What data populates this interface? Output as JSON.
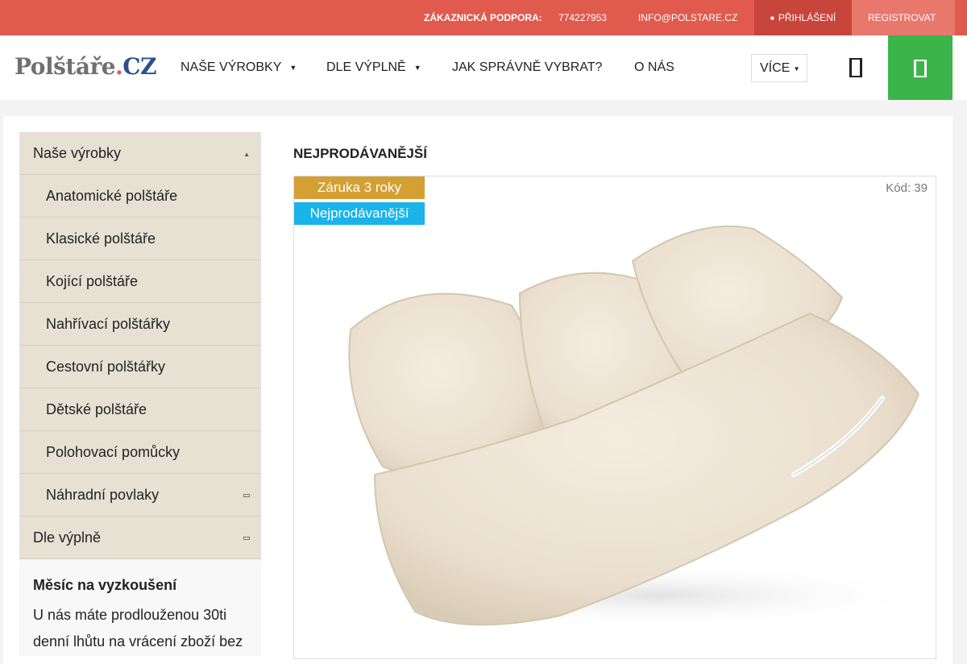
{
  "topbar": {
    "support_label": "ZÁKAZNICKÁ PODPORA:",
    "phone": "774227953",
    "email": "INFO@POLSTARE.CZ",
    "login": "PŘIHLÁŠENÍ",
    "register": "REGISTROVAT"
  },
  "header": {
    "logo_main": "Polštáře",
    "logo_dot": ".",
    "logo_tld": "CZ",
    "nav": [
      {
        "label": "NAŠE VÝROBKY"
      },
      {
        "label": "DLE VÝPLNĚ"
      },
      {
        "label": "JAK SPRÁVNĚ VYBRAT?"
      },
      {
        "label": "O NÁS"
      }
    ],
    "more": "VÍCE"
  },
  "sidebar": {
    "items": [
      {
        "label": "Naše výrobky"
      },
      {
        "label": "Anatomické polštáře"
      },
      {
        "label": "Klasické polštáře"
      },
      {
        "label": "Kojící polštáře"
      },
      {
        "label": "Nahřívací polštářky"
      },
      {
        "label": "Cestovní polštářky"
      },
      {
        "label": "Dětské polštáře"
      },
      {
        "label": "Polohovací pomůcky"
      },
      {
        "label": "Náhradní povlaky"
      },
      {
        "label": "Dle výplně"
      }
    ],
    "promo": {
      "title": "Měsíc na vyzkoušení",
      "text": "U nás máte prodlouženou 30ti denní lhůtu na vrácení zboží bez"
    }
  },
  "content": {
    "section_title": "NEJPRODÁVANĚJŠÍ",
    "product": {
      "badge_warranty": "Záruka 3 roky",
      "badge_best": "Nejprodávanější",
      "code": "Kód: 39"
    }
  },
  "colors": {
    "topbar": "#e05a4e",
    "login": "#c8453b",
    "register": "#e8776c",
    "cart": "#3bb54a",
    "sidebar_bg": "#e7e1d4",
    "badge_warranty": "#d4a034",
    "badge_best": "#1ab3ea",
    "logo_cz": "#2d4f8d"
  }
}
